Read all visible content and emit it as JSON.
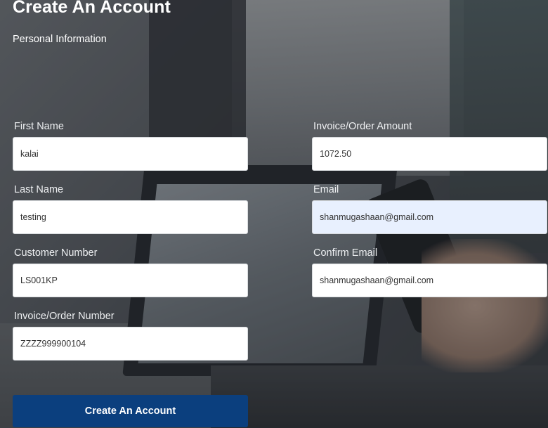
{
  "page": {
    "title": "Create An Account",
    "section_title": "Personal Information"
  },
  "form": {
    "first_name": {
      "label": "First Name",
      "value": "kalai"
    },
    "last_name": {
      "label": "Last Name",
      "value": "testing"
    },
    "customer_number": {
      "label": "Customer Number",
      "value": "LS001KP"
    },
    "invoice_order_number": {
      "label": "Invoice/Order Number",
      "value": "ZZZZ999900104"
    },
    "invoice_order_amount": {
      "label": "Invoice/Order Amount",
      "value": "1072.50"
    },
    "email": {
      "label": "Email",
      "value": "shanmugashaan@gmail.com"
    },
    "confirm_email": {
      "label": "Confirm Email",
      "value": "shanmugashaan@gmail.com"
    },
    "submit_label": "Create An Account"
  },
  "colors": {
    "primary_button": "#0b3f7e",
    "autofill_field": "#e8f0fe"
  }
}
